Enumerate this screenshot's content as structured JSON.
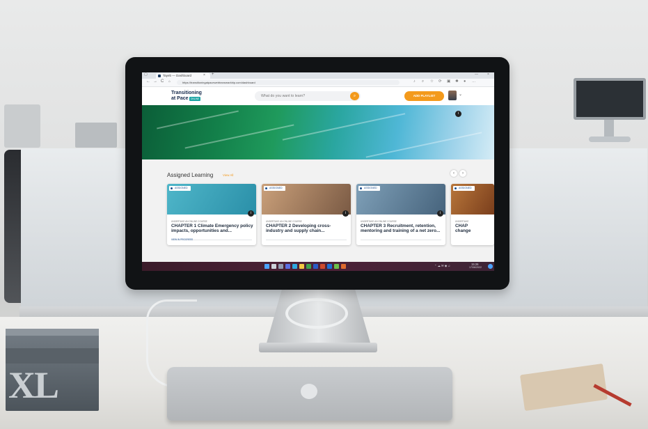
{
  "browser": {
    "tab_title": "Tayeb — Dashboard",
    "new_tab": "+",
    "close_tab": "×",
    "url": "https://transitioningatpacewebtransmarkhip.com/dashboard",
    "nav_back": "←",
    "nav_forward": "→",
    "nav_refresh": "C",
    "window_min": "—",
    "window_close": "×"
  },
  "site": {
    "logo_line1": "Transitioning",
    "logo_line2": "at Pace",
    "logo_tag": "ONLINE",
    "search_placeholder": "What do you want to learn?",
    "add_playlist_label": "ADD PLAYLIST",
    "hero_info": "i"
  },
  "assigned": {
    "title": "Assigned Learning",
    "view_all": "View All",
    "prev": "‹",
    "next": "›",
    "cards": [
      {
        "badge": "ASSIGNED",
        "type": "UNDERTAKE AN ONLINE COURSE",
        "title": "CHAPTER 1 Climate Emergency policy impacts, opportunities and...",
        "link": "VIEW IN PROGRESS",
        "num": "i",
        "color_a": "#4fb6c9",
        "color_b": "#2a8fa8"
      },
      {
        "badge": "ASSIGNED",
        "type": "UNDERTAKE AN ONLINE COURSE",
        "title": "CHAPTER 2 Developing cross-industry and supply chain...",
        "link": "",
        "num": "i",
        "color_a": "#caa07a",
        "color_b": "#7a5a44"
      },
      {
        "badge": "ASSIGNED",
        "type": "UNDERTAKE AN ONLINE COURSE",
        "title": "CHAPTER 3 Recruitment, retention, mentoring and training of a net zero...",
        "link": "",
        "num": "i",
        "color_a": "#7fa0b8",
        "color_b": "#46637c"
      },
      {
        "badge": "ASSIGNED",
        "type": "UNDERTAKE",
        "title": "CHAP change",
        "link": "",
        "num": "",
        "color_a": "#b8763a",
        "color_b": "#7a3e1c"
      }
    ]
  },
  "taskbar": {
    "time": "15:26",
    "date": "17/06/2022"
  },
  "desk": {
    "book_text": "XL"
  }
}
